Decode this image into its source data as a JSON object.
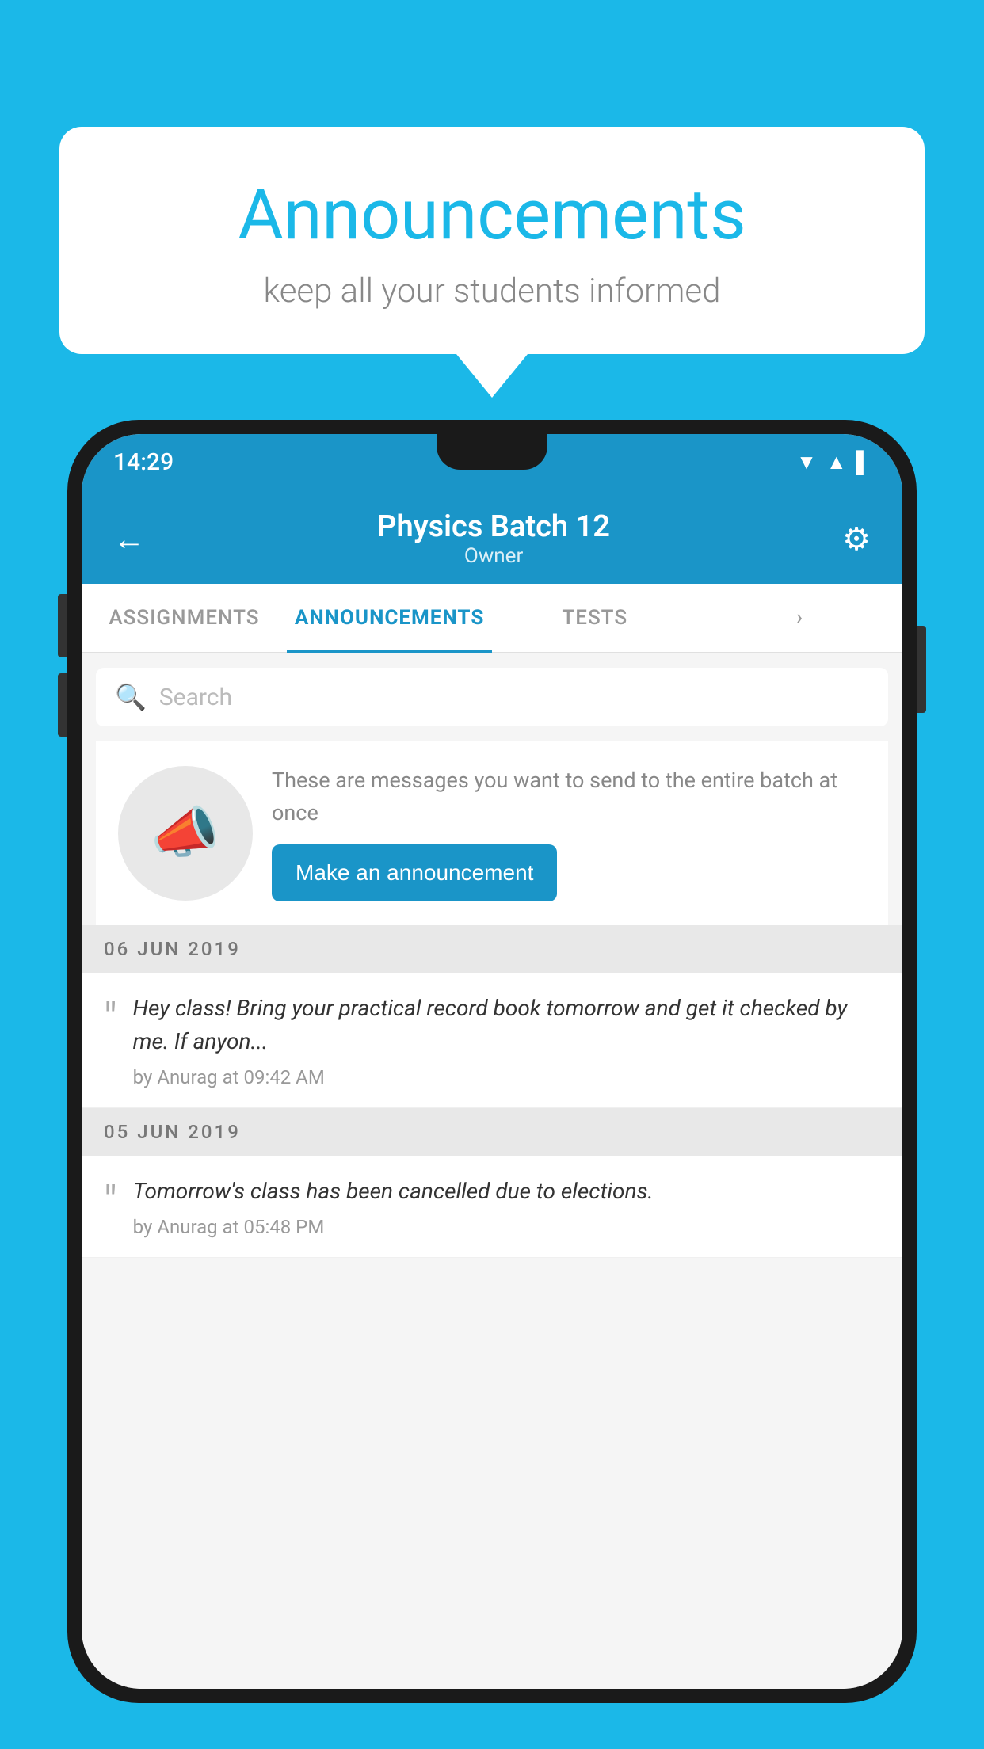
{
  "bubble": {
    "title": "Announcements",
    "subtitle": "keep all your students informed"
  },
  "statusBar": {
    "time": "14:29",
    "icons": [
      "▼",
      "▲",
      "▌"
    ]
  },
  "header": {
    "title": "Physics Batch 12",
    "subtitle": "Owner",
    "backLabel": "←",
    "gearLabel": "⚙"
  },
  "tabs": [
    {
      "label": "ASSIGNMENTS",
      "active": false
    },
    {
      "label": "ANNOUNCEMENTS",
      "active": true
    },
    {
      "label": "TESTS",
      "active": false
    },
    {
      "label": "",
      "active": false
    }
  ],
  "search": {
    "placeholder": "Search"
  },
  "promo": {
    "text": "These are messages you want to send to the entire batch at once",
    "buttonLabel": "Make an announcement"
  },
  "announcements": [
    {
      "date": "06  JUN  2019",
      "text": "Hey class! Bring your practical record book tomorrow and get it checked by me. If anyon...",
      "meta": "by Anurag at 09:42 AM"
    },
    {
      "date": "05  JUN  2019",
      "text": "Tomorrow's class has been cancelled due to elections.",
      "meta": "by Anurag at 05:48 PM"
    }
  ],
  "colors": {
    "appBlue": "#1a95c8",
    "bgBlue": "#1BB8E8"
  }
}
